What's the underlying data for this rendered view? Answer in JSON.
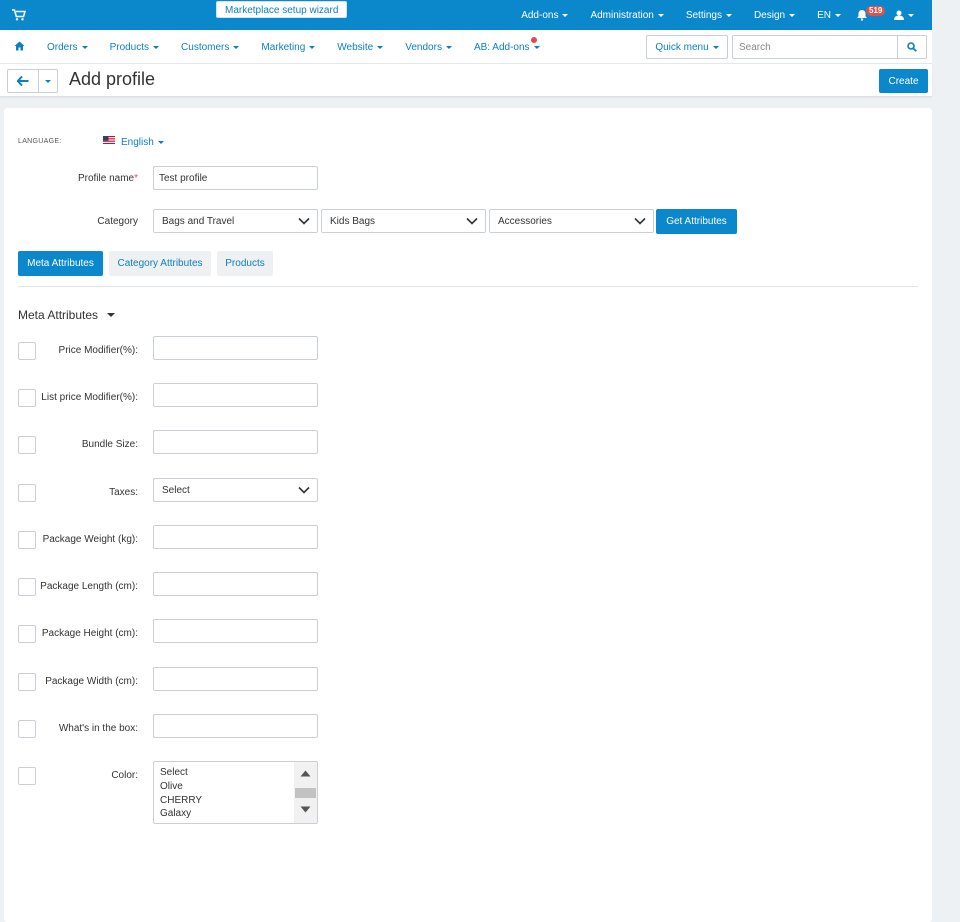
{
  "topbar": {
    "wizard_label": "Marketplace setup wizard",
    "items": [
      "Add-ons",
      "Administration",
      "Settings",
      "Design",
      "EN"
    ],
    "notifications_count": "519",
    "icons": [
      "cart-icon",
      "bell-icon",
      "user-icon"
    ]
  },
  "navbar": {
    "items": [
      "Orders",
      "Products",
      "Customers",
      "Marketing",
      "Website",
      "Vendors",
      "AB: Add-ons"
    ],
    "quick_menu_label": "Quick menu",
    "search_placeholder": "Search"
  },
  "titlebar": {
    "title": "Add profile",
    "create_label": "Create"
  },
  "form": {
    "language_label": "LANGUAGE:",
    "language_value": "English",
    "profile_name_label": "Profile name",
    "profile_name_required": "*",
    "profile_name_value": "Test profile",
    "category_label": "Category",
    "categories": [
      "Bags and Travel",
      "Kids Bags",
      "Accessories"
    ],
    "get_attributes_label": "Get Attributes"
  },
  "tabs": [
    "Meta Attributes",
    "Category Attributes",
    "Products"
  ],
  "section": {
    "title": "Meta Attributes",
    "attributes": [
      {
        "label": "Price Modifier(%):",
        "type": "text",
        "value": ""
      },
      {
        "label": "List price Modifier(%):",
        "type": "text",
        "value": ""
      },
      {
        "label": "Bundle Size:",
        "type": "text",
        "value": ""
      },
      {
        "label": "Taxes:",
        "type": "select",
        "value": "Select"
      },
      {
        "label": "Package Weight (kg):",
        "type": "text",
        "value": ""
      },
      {
        "label": "Package Length (cm):",
        "type": "text",
        "value": ""
      },
      {
        "label": "Package Height (cm):",
        "type": "text",
        "value": ""
      },
      {
        "label": "Package Width (cm):",
        "type": "text",
        "value": ""
      },
      {
        "label": "What's in the box:",
        "type": "text",
        "value": ""
      },
      {
        "label": "Color:",
        "type": "listbox",
        "options": [
          "Select",
          "Olive",
          "CHERRY",
          "Galaxy"
        ]
      }
    ]
  },
  "colors": {
    "primary": "#0b88cc",
    "link": "#0b7fc1",
    "badge": "#d9534f"
  }
}
